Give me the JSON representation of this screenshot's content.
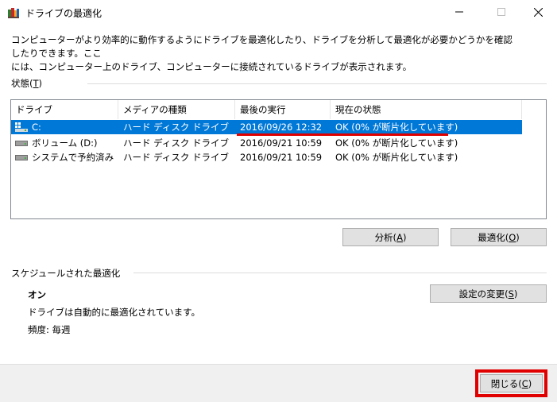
{
  "window": {
    "title": "ドライブの最適化",
    "min_glyph": "—",
    "max_glyph": "☐",
    "close_glyph": "✕"
  },
  "description": {
    "line1": "コンピューターがより効率的に動作するようにドライブを最適化したり、ドライブを分析して最適化が必要かどうかを確認したりできます。ここ",
    "line2": "には、コンピューター上のドライブ、コンピューターに接続されているドライブが表示されます。"
  },
  "status_section": {
    "label": "状態(",
    "accel": "T",
    "label_end": ")"
  },
  "drive_table": {
    "columns": [
      "ドライブ",
      "メディアの種類",
      "最後の実行",
      "現在の状態"
    ],
    "rows": [
      {
        "drive": "C:",
        "media": "ハード ディスク ドライブ",
        "last_run": "2016/09/26 12:32",
        "status": "OK (0% が断片化しています)",
        "selected": true,
        "icon": "windows-drive-icon"
      },
      {
        "drive": "ボリューム (D:)",
        "media": "ハード ディスク ドライブ",
        "last_run": "2016/09/21 10:59",
        "status": "OK (0% が断片化しています)",
        "selected": false,
        "icon": "hard-drive-icon"
      },
      {
        "drive": "システムで予約済み",
        "media": "ハード ディスク ドライブ",
        "last_run": "2016/09/21 10:59",
        "status": "OK (0% が断片化しています)",
        "selected": false,
        "icon": "hard-drive-icon"
      }
    ]
  },
  "buttons": {
    "analyze": {
      "label": "分析(",
      "accel": "A",
      "end": ")"
    },
    "optimize": {
      "label": "最適化(",
      "accel": "O",
      "end": ")"
    },
    "change_settings": {
      "label": "設定の変更(",
      "accel": "S",
      "end": ")"
    },
    "close": {
      "label": "閉じる(",
      "accel": "C",
      "end": ")"
    }
  },
  "schedule": {
    "header": "スケジュールされた最適化",
    "state": "オン",
    "auto_text": "ドライブは自動的に最適化されています。",
    "frequency": "頻度: 毎週"
  },
  "colors": {
    "selection": "#0078d7",
    "annotation_red": "#e00000"
  }
}
